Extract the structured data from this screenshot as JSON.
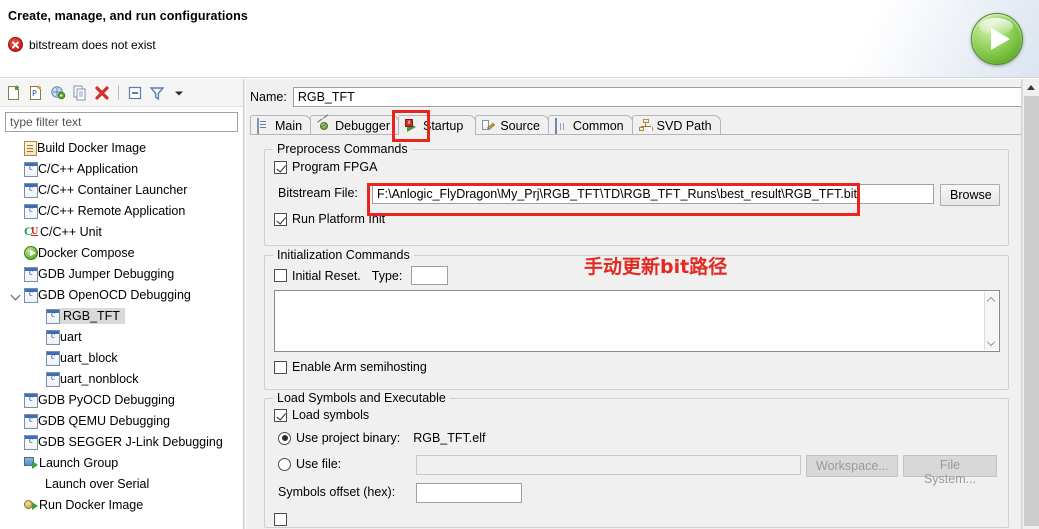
{
  "header": {
    "title": "Create, manage, and run configurations",
    "error_message": "bitstream does not exist",
    "error_icon": "error-circle-icon",
    "run_icon": "run-play-icon"
  },
  "toolbar": {
    "buttons": [
      {
        "name": "new-configuration-icon",
        "label": "New launch configuration"
      },
      {
        "name": "new-prototype-icon",
        "label": "New prototype"
      },
      {
        "name": "export-icon",
        "label": "Export"
      },
      {
        "name": "duplicate-icon",
        "label": "Duplicate"
      },
      {
        "name": "delete-icon",
        "label": "Delete"
      },
      {
        "name": "collapse-all-icon",
        "label": "Collapse All"
      },
      {
        "name": "filter-icon",
        "label": "Filter launch configurations"
      },
      {
        "name": "view-menu-icon",
        "label": "View Menu"
      }
    ]
  },
  "filter": {
    "placeholder": "type filter text",
    "value": ""
  },
  "tree": {
    "items": [
      {
        "label": "Build Docker Image",
        "icon": "docker-build-icon",
        "indent": 0,
        "expander": "none",
        "selected": false
      },
      {
        "label": "C/C++ Application",
        "icon": "c-cpp-icon",
        "indent": 0,
        "expander": "none",
        "selected": false
      },
      {
        "label": "C/C++ Container Launcher",
        "icon": "c-cpp-icon",
        "indent": 0,
        "expander": "none",
        "selected": false
      },
      {
        "label": "C/C++ Remote Application",
        "icon": "c-cpp-icon",
        "indent": 0,
        "expander": "none",
        "selected": false
      },
      {
        "label": "C/C++ Unit",
        "icon": "cunit-icon",
        "indent": 0,
        "expander": "none",
        "selected": false
      },
      {
        "label": "Docker Compose",
        "icon": "play-green-icon",
        "indent": 0,
        "expander": "none",
        "selected": false
      },
      {
        "label": "GDB Jumper Debugging",
        "icon": "c-cpp-icon",
        "indent": 0,
        "expander": "none",
        "selected": false
      },
      {
        "label": "GDB OpenOCD Debugging",
        "icon": "c-cpp-icon",
        "indent": 0,
        "expander": "expanded",
        "selected": false
      },
      {
        "label": "RGB_TFT",
        "icon": "c-cpp-icon",
        "indent": 1,
        "expander": "none",
        "selected": true
      },
      {
        "label": "uart",
        "icon": "c-cpp-icon",
        "indent": 1,
        "expander": "none",
        "selected": false
      },
      {
        "label": "uart_block",
        "icon": "c-cpp-icon",
        "indent": 1,
        "expander": "none",
        "selected": false
      },
      {
        "label": "uart_nonblock",
        "icon": "c-cpp-icon",
        "indent": 1,
        "expander": "none",
        "selected": false
      },
      {
        "label": "GDB PyOCD Debugging",
        "icon": "c-cpp-icon",
        "indent": 0,
        "expander": "none",
        "selected": false
      },
      {
        "label": "GDB QEMU Debugging",
        "icon": "c-cpp-icon",
        "indent": 0,
        "expander": "none",
        "selected": false
      },
      {
        "label": "GDB SEGGER J-Link Debugging",
        "icon": "c-cpp-icon",
        "indent": 0,
        "expander": "none",
        "selected": false
      },
      {
        "label": "Launch Group",
        "icon": "launch-group-icon",
        "indent": 0,
        "expander": "none",
        "selected": false
      },
      {
        "label": "Launch over Serial",
        "icon": "none",
        "indent": 0,
        "expander": "none",
        "selected": false
      },
      {
        "label": "Run Docker Image",
        "icon": "run-docker-icon",
        "indent": 0,
        "expander": "none",
        "selected": false
      }
    ]
  },
  "config": {
    "name_label": "Name:",
    "name_value": "RGB_TFT"
  },
  "tabs": [
    {
      "label": "Main",
      "icon": "main-doc-icon",
      "active": false
    },
    {
      "label": "Debugger",
      "icon": "debugger-bug-icon",
      "active": false
    },
    {
      "label": "Startup",
      "icon": "startup-arrow-error-icon",
      "active": true
    },
    {
      "label": "Source",
      "icon": "source-edit-icon",
      "active": false
    },
    {
      "label": "Common",
      "icon": "common-table-icon",
      "active": false
    },
    {
      "label": "SVD Path",
      "icon": "svd-tree-icon",
      "active": false
    }
  ],
  "preprocess": {
    "group_title": "Preprocess Commands",
    "program_fpga_label": "Program FPGA",
    "program_fpga_checked": true,
    "bitstream_label": "Bitstream File:",
    "bitstream_value": "F:\\Anlogic_FlyDragon\\My_Prj\\RGB_TFT\\TD\\RGB_TFT_Runs\\best_result\\RGB_TFT.bit",
    "browse_label": "Browse",
    "run_platform_init_label": "Run Platform Init",
    "run_platform_init_checked": true
  },
  "initialization": {
    "group_title": "Initialization Commands",
    "initial_reset_label": "Initial Reset.",
    "initial_reset_checked": false,
    "type_label": "Type:",
    "type_value": "",
    "commands_value": "",
    "semihosting_label": "Enable Arm semihosting",
    "semihosting_checked": false
  },
  "load_symbols": {
    "group_title": "Load Symbols and Executable",
    "load_symbols_label": "Load symbols",
    "load_symbols_checked": true,
    "use_project_binary_label": "Use project binary:",
    "use_project_binary_selected": true,
    "project_binary_value": "RGB_TFT.elf",
    "use_file_label": "Use file:",
    "use_file_selected": false,
    "use_file_value": "",
    "workspace_label": "Workspace...",
    "file_system_label": "File System...",
    "symbols_offset_label": "Symbols offset (hex):",
    "symbols_offset_value": ""
  },
  "annotations": {
    "note_text": "手动更新bit路径",
    "note_color": "#e02a22",
    "highlight_color": "#e8241c"
  }
}
